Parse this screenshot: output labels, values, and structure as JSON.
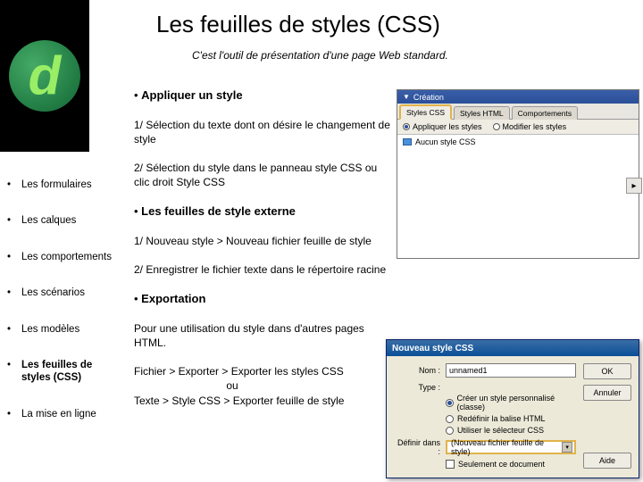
{
  "header": {
    "title": "Les feuilles de styles (CSS)",
    "subtitle": "C'est l'outil de présentation d'une page Web standard."
  },
  "nav": {
    "items": [
      {
        "label": "Les formulaires",
        "active": false
      },
      {
        "label": "Les calques",
        "active": false
      },
      {
        "label": "Les comportements",
        "active": false
      },
      {
        "label": "Les scénarios",
        "active": false
      },
      {
        "label": "Les modèles",
        "active": false
      },
      {
        "label": "Les feuilles de styles (CSS)",
        "active": true
      },
      {
        "label": "La mise en ligne",
        "active": false
      }
    ]
  },
  "content": {
    "apply_heading": "Appliquer un style",
    "apply_step1": "1/ Sélection du texte dont on désire le changement de style",
    "apply_step2": "2/ Sélection du style dans le panneau style CSS ou clic droit Style CSS",
    "external_heading": "Les feuilles de style externe",
    "external_step1": "1/ Nouveau style > Nouveau fichier feuille de style",
    "external_step2": "2/ Enregistrer le fichier texte dans le répertoire racine",
    "export_heading": "Exportation",
    "export_text": "Pour une utilisation du style dans d'autres pages HTML.",
    "export_path1": "Fichier > Exporter > Exporter les styles CSS",
    "export_or": "ou",
    "export_path2": "Texte > Style CSS > Exporter feuille de style"
  },
  "panel": {
    "title": "Création",
    "tabs": [
      "Styles CSS",
      "Styles HTML",
      "Comportements"
    ],
    "toolbar": {
      "apply": "Appliquer les styles",
      "edit": "Modifier les styles"
    },
    "list_item": "Aucun style CSS",
    "arrow": "▸"
  },
  "dialog": {
    "title": "Nouveau style CSS",
    "name_label": "Nom :",
    "name_value": "unnamed1",
    "type_label": "Type :",
    "type_options": [
      "Créer un style personnalisé (classe)",
      "Redéfinir la balise HTML",
      "Utiliser le sélecteur CSS"
    ],
    "define_label": "Définir dans :",
    "define_value": "(Nouveau fichier feuille de style)",
    "only_doc": "Seulement ce document",
    "buttons": {
      "ok": "OK",
      "cancel": "Annuler",
      "help": "Aide"
    }
  }
}
